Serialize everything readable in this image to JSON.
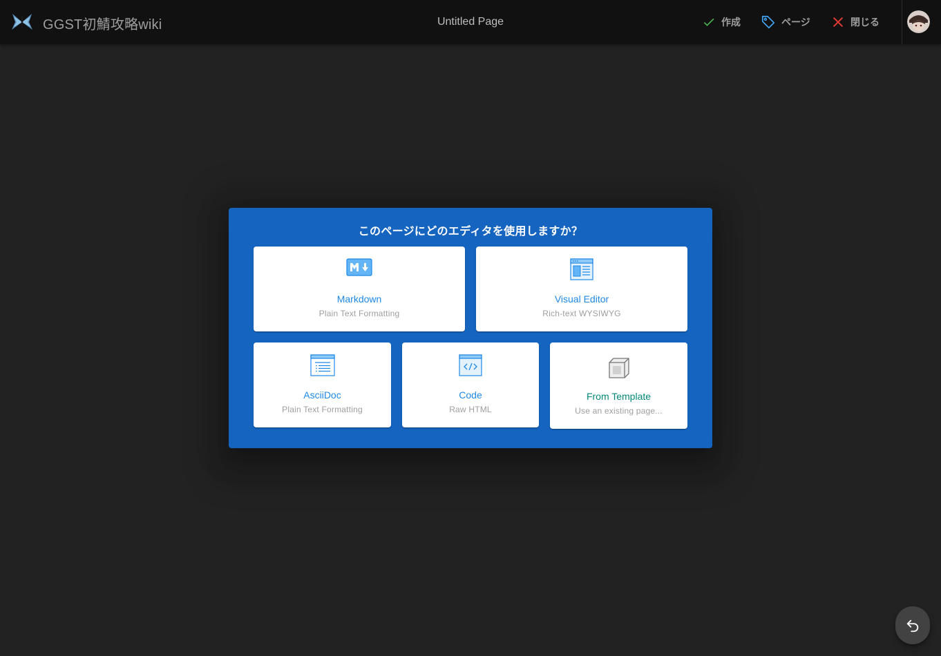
{
  "header": {
    "site_title": "GGST初鯖攻略wiki",
    "page_title": "Untitled Page",
    "actions": [
      {
        "label": "作成",
        "icon": "check-icon",
        "color": "#4caf50"
      },
      {
        "label": "ページ",
        "icon": "tag-icon",
        "color": "#42a5f5"
      },
      {
        "label": "閉じる",
        "icon": "close-icon",
        "color": "#e53935"
      }
    ],
    "avatar_icon": "user-avatar"
  },
  "dialog": {
    "title": "このページにどのエディタを使用しますか？",
    "background": "#1565c0",
    "editors": [
      {
        "label": "Markdown",
        "sub": "Plain Text Formatting",
        "icon": "markdown-icon"
      },
      {
        "label": "Visual Editor",
        "sub": "Rich-text WYSIWYG",
        "icon": "visual-editor-icon"
      },
      {
        "label": "AsciiDoc",
        "sub": "Plain Text Formatting",
        "icon": "asciidoc-icon"
      },
      {
        "label": "Code",
        "sub": "Raw HTML",
        "icon": "code-icon"
      },
      {
        "label": "From Template",
        "sub": "Use an existing page...",
        "icon": "template-box-icon"
      }
    ]
  },
  "fab": {
    "icon": "undo-icon"
  }
}
